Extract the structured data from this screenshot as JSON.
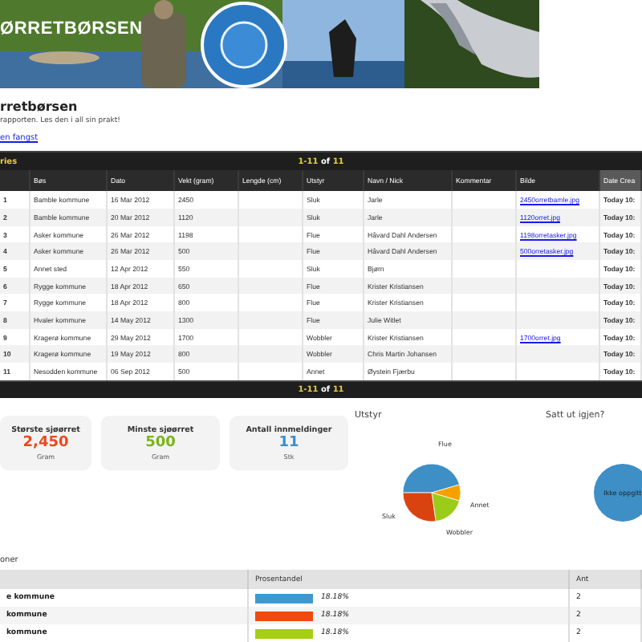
{
  "banner": {
    "title": "ØRRETBØRSEN"
  },
  "intro": {
    "title": "rretbørsen",
    "text": "rapporten. Les den i all sin prakt!",
    "link": "en fangst"
  },
  "toolbar": {
    "label": "ries",
    "range": "1-11",
    "of": "of",
    "total": "11"
  },
  "table": {
    "columns": [
      {
        "selected": false
      },
      {
        "label": "Bøs",
        "selected": false
      },
      {
        "label": "Dato",
        "selected": false
      },
      {
        "label": "Vekt (gram)",
        "selected": false
      },
      {
        "label": "Lengde (cm)",
        "selected": false
      },
      {
        "label": "Utstyr",
        "selected": false
      },
      {
        "label": "Navn / Nick",
        "selected": false
      },
      {
        "label": "Kommentar",
        "selected": false
      },
      {
        "label": "Bilde",
        "selected": false
      },
      {
        "label": "Date Crea",
        "selected": true
      }
    ],
    "rows": [
      [
        "1",
        "Bamble kommune",
        "16 Mar 2012",
        "2450",
        "",
        "Sluk",
        "Jarle",
        "",
        "2450orretbamle.jpg",
        "Today 10:"
      ],
      [
        "2",
        "Bamble kommune",
        "20 Mar 2012",
        "1120",
        "",
        "Sluk",
        "Jarle",
        "",
        "1120orret.jpg",
        "Today 10:"
      ],
      [
        "3",
        "Asker kommune",
        "26 Mar 2012",
        "1198",
        "",
        "Flue",
        "Håvard Dahl Andersen",
        "",
        "1198orretasker.jpg",
        "Today 10:"
      ],
      [
        "4",
        "Asker kommune",
        "26 Mar 2012",
        "500",
        "",
        "Flue",
        "Håvard Dahl Andersen",
        "",
        "500orretasker.jpg",
        "Today 10:"
      ],
      [
        "5",
        "Annet sted",
        "12 Apr 2012",
        "550",
        "",
        "Sluk",
        "Bjørn",
        "",
        "",
        "Today 10:"
      ],
      [
        "6",
        "Rygge kommune",
        "18 Apr 2012",
        "650",
        "",
        "Flue",
        "Krister Kristiansen",
        "",
        "",
        "Today 10:"
      ],
      [
        "7",
        "Rygge kommune",
        "18 Apr 2012",
        "800",
        "",
        "Flue",
        "Krister Kristiansen",
        "",
        "",
        "Today 10:"
      ],
      [
        "8",
        "Hvaler kommune",
        "14 May 2012",
        "1300",
        "",
        "Flue",
        "Julie Witlet",
        "",
        "",
        "Today 10:"
      ],
      [
        "9",
        "Kragerø kommune",
        "29 May 2012",
        "1700",
        "",
        "Wobbler",
        "Krister Kristiansen",
        "",
        "1700orret.jpg",
        "Today 10:"
      ],
      [
        "10",
        "Kragerø kommune",
        "19 May 2012",
        "800",
        "",
        "Wobbler",
        "Chris Martin Johansen",
        "",
        "",
        "Today 10:"
      ],
      [
        "11",
        "Nesodden kommune",
        "06 Sep 2012",
        "500",
        "",
        "Annet",
        "Øystein Fjærbu",
        "",
        "",
        "Today 10:"
      ]
    ]
  },
  "footer": {
    "range": "1-11",
    "of": "of",
    "total": "11"
  },
  "stats": [
    {
      "label": "Største sjøørret",
      "value": "2,450",
      "unit": "Gram",
      "color": "#e8491d"
    },
    {
      "label": "Minste sjøørret",
      "value": "500",
      "unit": "Gram",
      "color": "#7bb31a"
    },
    {
      "label": "Antall innmeldinger",
      "value": "11",
      "unit": "Stk",
      "color": "#3d8fc6"
    }
  ],
  "charts": [
    {
      "chart_data": {
        "type": "pie",
        "title": "Utstyr",
        "categories": [
          "Flue",
          "Annet",
          "Wobbler",
          "Sluk"
        ],
        "series": [
          {
            "values": [
              45.46,
              9.09,
              18.18,
              27.27
            ]
          }
        ],
        "colors": [
          "#3d8fc6",
          "#f6a000",
          "#9ccc1a",
          "#d9430f"
        ]
      }
    },
    {
      "chart_data": {
        "type": "pie",
        "title": "Satt ut igjen?",
        "categories": [
          "Ikke oppgitt"
        ],
        "series": [
          {
            "values": [
              100
            ]
          }
        ],
        "colors": [
          "#3d8fc6"
        ]
      }
    }
  ],
  "regions": {
    "title": "oner",
    "columns": [
      "Prosentandel",
      "Ant"
    ],
    "rows": [
      {
        "name": "e kommune",
        "percent": "18.18%",
        "level": 0.1818,
        "color": "#3d9ad1",
        "count": "2"
      },
      {
        "name": "kommune",
        "percent": "18.18%",
        "level": 0.1818,
        "color": "#f04a0e",
        "count": "2"
      },
      {
        "name": "kommune",
        "percent": "18.18%",
        "level": 0.1818,
        "color": "#a6cf12",
        "count": "2"
      }
    ]
  }
}
